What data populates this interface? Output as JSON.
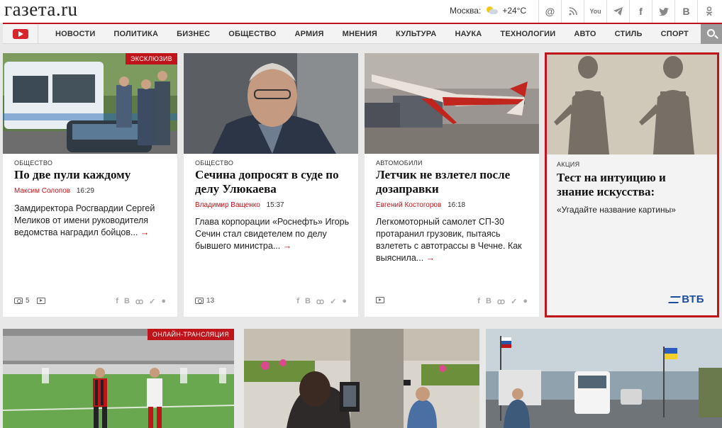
{
  "header": {
    "logo": "газета.ru",
    "weather_city": "Москва:",
    "weather_temp": "+24°C",
    "social": [
      "@",
      "rss",
      "You",
      "tg",
      "f",
      "tw",
      "B",
      "ok"
    ]
  },
  "nav": {
    "items": [
      "НОВОСТИ",
      "ПОЛИТИКА",
      "БИЗНЕС",
      "ОБЩЕСТВО",
      "АРМИЯ",
      "МНЕНИЯ",
      "КУЛЬТУРА",
      "НАУКА",
      "ТЕХНОЛОГИИ",
      "АВТО",
      "СТИЛЬ",
      "СПОРТ"
    ]
  },
  "cards": [
    {
      "badge": "ЭКСКЛЮЗИВ",
      "category": "ОБЩЕСТВО",
      "title": "По две пули каждому",
      "author": "Максим Солопов",
      "time": "16:29",
      "lead": "Замдиректора Росгвардии Сергей Меликов от имени руководителя ведомства наградил бойцов...",
      "photos": "5"
    },
    {
      "category": "ОБЩЕСТВО",
      "title": "Сечина допросят в суде по делу Улюкаева",
      "author": "Владимир Ващенко",
      "time": "15:37",
      "lead": "Глава корпорации «Роснефть» Игорь Сечин стал свидетелем по делу бывшего министра...",
      "photos": "13"
    },
    {
      "category": "АВТОМОБИЛИ",
      "title": "Летчик не взлетел после дозаправки",
      "author": "Евгений Костогоров",
      "time": "16:18",
      "lead": "Легкомоторный самолет СП-30 протаранил грузовик, пытаясь взлететь с автотрассы в Чечне. Как выяснила..."
    }
  ],
  "promo": {
    "category": "АКЦИЯ",
    "title": "Тест на интуицию и знание искусства:",
    "lead": "«Угадайте название картины»",
    "brand": "ВТБ"
  },
  "bottom": {
    "badge": "ОНЛАЙН-ТРАНСЛЯЦИЯ"
  },
  "share_icons": [
    "f",
    "B",
    "ok",
    "tw",
    "vk"
  ],
  "arrow": "→",
  "colors": {
    "accent": "#c0141b",
    "vtb": "#1c4d9b"
  }
}
